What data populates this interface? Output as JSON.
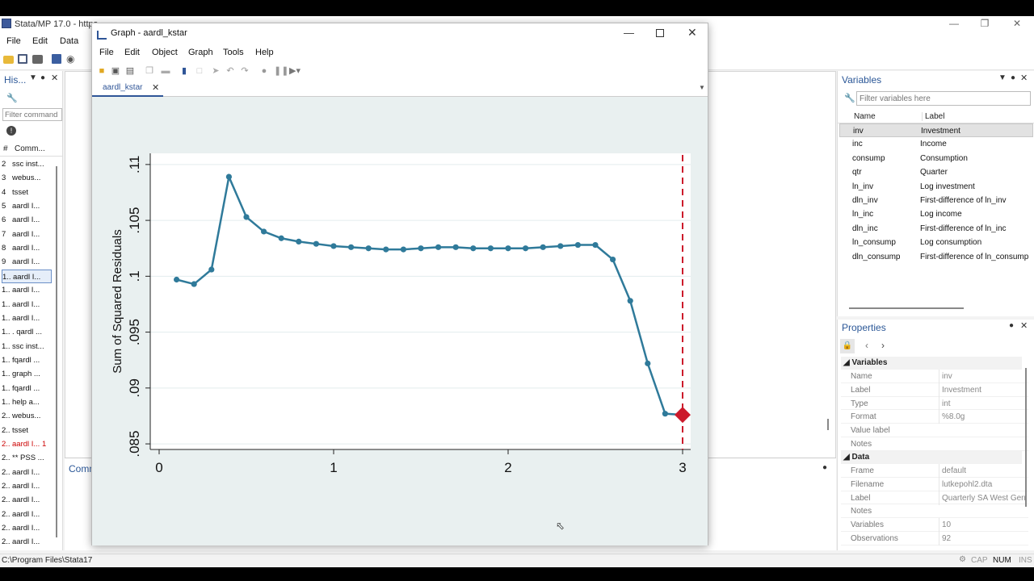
{
  "main_window": {
    "title": "Stata/MP 17.0 - https",
    "menus": [
      "File",
      "Edit",
      "Data"
    ]
  },
  "history": {
    "title": "His...",
    "filter_placeholder": "Filter command",
    "col_num": "#",
    "col_cmd": "Comm...",
    "rows": [
      {
        "n": "2",
        "c": "ssc inst..."
      },
      {
        "n": "3",
        "c": "webus..."
      },
      {
        "n": "4",
        "c": "tsset"
      },
      {
        "n": "5",
        "c": "aardl I..."
      },
      {
        "n": "6",
        "c": "aardl I..."
      },
      {
        "n": "7",
        "c": "aardl I..."
      },
      {
        "n": "8",
        "c": "aardl I..."
      },
      {
        "n": "9",
        "c": "aardl I..."
      },
      {
        "n": "1..",
        "c": "aardl I..."
      },
      {
        "n": "1..",
        "c": "aardl I..."
      },
      {
        "n": "1..",
        "c": "aardl I..."
      },
      {
        "n": "1..",
        "c": "aardl I..."
      },
      {
        "n": "1..",
        "c": ". qardl ..."
      },
      {
        "n": "1..",
        "c": "ssc inst..."
      },
      {
        "n": "1..",
        "c": "fqardl ..."
      },
      {
        "n": "1..",
        "c": "graph ..."
      },
      {
        "n": "1..",
        "c": "fqardl ..."
      },
      {
        "n": "1..",
        "c": "help a..."
      },
      {
        "n": "2..",
        "c": "webus..."
      },
      {
        "n": "2..",
        "c": "tsset"
      },
      {
        "n": "2..",
        "c": "aardl I...  1"
      },
      {
        "n": "2..",
        "c": "** PSS ..."
      },
      {
        "n": "2..",
        "c": "aardl I..."
      },
      {
        "n": "2..",
        "c": "aardl I..."
      },
      {
        "n": "2..",
        "c": "aardl I..."
      },
      {
        "n": "2..",
        "c": "aardl I..."
      },
      {
        "n": "2..",
        "c": "aardl I..."
      },
      {
        "n": "2..",
        "c": "aardl I..."
      }
    ]
  },
  "command_panel": {
    "title": "Comm"
  },
  "variables": {
    "title": "Variables",
    "filter_placeholder": "Filter variables here",
    "col_name": "Name",
    "col_label": "Label",
    "rows": [
      {
        "name": "inv",
        "label": "Investment"
      },
      {
        "name": "inc",
        "label": "Income"
      },
      {
        "name": "consump",
        "label": "Consumption"
      },
      {
        "name": "qtr",
        "label": "Quarter"
      },
      {
        "name": "ln_inv",
        "label": "Log investment"
      },
      {
        "name": "dln_inv",
        "label": "First-difference of ln_inv"
      },
      {
        "name": "ln_inc",
        "label": "Log income"
      },
      {
        "name": "dln_inc",
        "label": "First-difference of ln_inc"
      },
      {
        "name": "ln_consump",
        "label": "Log consumption"
      },
      {
        "name": "dln_consump",
        "label": "First-difference of ln_consump"
      }
    ]
  },
  "properties": {
    "title": "Properties",
    "sec_variables": "Variables",
    "var_rows": [
      {
        "k": "Name",
        "v": "inv"
      },
      {
        "k": "Label",
        "v": "Investment"
      },
      {
        "k": "Type",
        "v": "int"
      },
      {
        "k": "Format",
        "v": "%8.0g"
      },
      {
        "k": "Value label",
        "v": ""
      },
      {
        "k": "Notes",
        "v": ""
      }
    ],
    "sec_data": "Data",
    "data_rows": [
      {
        "k": "Frame",
        "v": "default"
      },
      {
        "k": "Filename",
        "v": "lutkepohl2.dta"
      },
      {
        "k": "Label",
        "v": "Quarterly SA West Gerr"
      },
      {
        "k": "Notes",
        "v": ""
      },
      {
        "k": "Variables",
        "v": "10"
      },
      {
        "k": "Observations",
        "v": "92"
      }
    ]
  },
  "status": {
    "path": "C:\\Program Files\\Stata17",
    "cap": "CAP",
    "num": "NUM",
    "ins": "INS"
  },
  "graph_window": {
    "title": "Graph - aardl_kstar",
    "menus": [
      "File",
      "Edit",
      "Object",
      "Graph",
      "Tools",
      "Help"
    ],
    "tab": "aardl_kstar"
  },
  "chart_data": {
    "type": "line",
    "title": "",
    "xlabel": "",
    "ylabel": "Sum of Squared Residuals",
    "xlim": [
      0,
      3
    ],
    "ylim": [
      0.0845,
      0.111
    ],
    "xticks": [
      {
        "v": 0,
        "l": "0"
      },
      {
        "v": 1,
        "l": "1"
      },
      {
        "v": 2,
        "l": "2"
      },
      {
        "v": 3,
        "l": "3"
      }
    ],
    "yticks": [
      {
        "v": 0.085,
        "l": ".085"
      },
      {
        "v": 0.09,
        "l": ".09"
      },
      {
        "v": 0.095,
        "l": ".095"
      },
      {
        "v": 0.1,
        "l": ".1"
      },
      {
        "v": 0.105,
        "l": ".105"
      },
      {
        "v": 0.11,
        "l": ".11"
      }
    ],
    "grid": true,
    "line_color": "#2f7a9a",
    "marker_color": "#2f7a9a",
    "highlight_color": "#cc1a2b",
    "vline_x": 3,
    "series": [
      {
        "x": [
          0.1,
          0.2,
          0.3,
          0.4,
          0.5,
          0.6,
          0.7,
          0.8,
          0.9,
          1.0,
          1.1,
          1.2,
          1.3,
          1.4,
          1.5,
          1.6,
          1.7,
          1.8,
          1.9,
          2.0,
          2.1,
          2.2,
          2.3,
          2.4,
          2.5,
          2.6,
          2.7,
          2.8,
          2.9,
          3.0
        ],
        "y": [
          0.0997,
          0.0993,
          0.1006,
          0.1089,
          0.1053,
          0.104,
          0.1034,
          0.1031,
          0.1029,
          0.1027,
          0.1026,
          0.1025,
          0.1024,
          0.1024,
          0.1025,
          0.1026,
          0.1026,
          0.1025,
          0.1025,
          0.1025,
          0.1025,
          0.1026,
          0.1027,
          0.1028,
          0.1028,
          0.1015,
          0.0978,
          0.0922,
          0.0877,
          0.0876
        ]
      }
    ],
    "highlight": {
      "x": 3.0,
      "y": 0.0876
    }
  }
}
